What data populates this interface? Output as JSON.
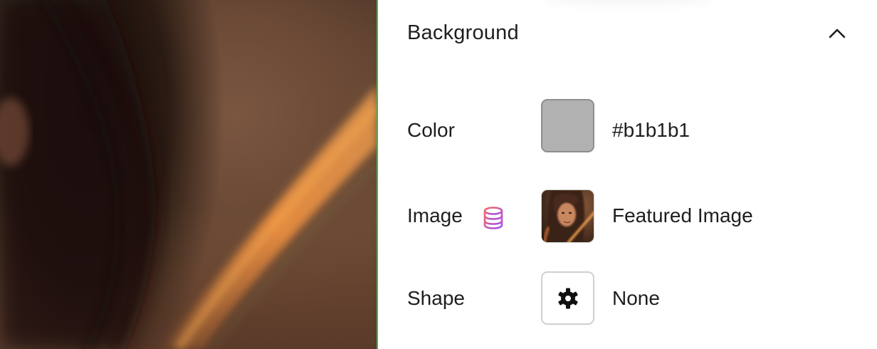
{
  "section": {
    "title": "Background",
    "collapse_icon": "chevron-up-icon"
  },
  "rows": {
    "color": {
      "label": "Color",
      "value": "#b1b1b1",
      "swatch": "#b1b1b1"
    },
    "image": {
      "label": "Image",
      "value": "Featured Image",
      "dynamic_icon": "database-icon"
    },
    "shape": {
      "label": "Shape",
      "value": "None",
      "icon": "gear-icon"
    }
  },
  "colors": {
    "accent_edge": "#3bb54a",
    "dynamic_gradient_start": "#f06a5e",
    "dynamic_gradient_end": "#a64bf4"
  }
}
